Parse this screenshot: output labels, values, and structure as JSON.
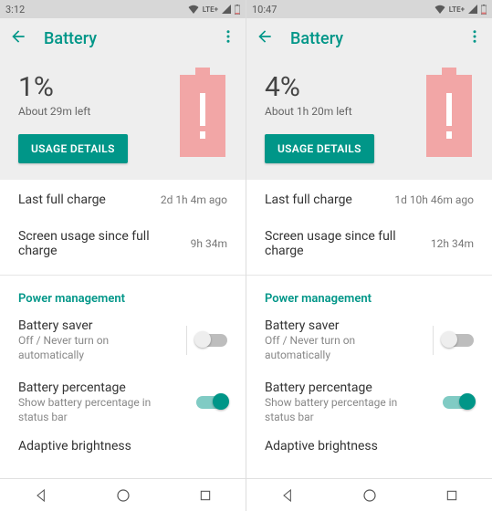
{
  "left": {
    "statusbar": {
      "time": "3:12",
      "network_label": "LTE+"
    },
    "appbar": {
      "title": "Battery"
    },
    "hero": {
      "percent": "1%",
      "time_left": "About 29m left",
      "usage_btn": "USAGE DETAILS"
    },
    "stats": {
      "last_full_label": "Last full charge",
      "last_full_value": "2d 1h 4m ago",
      "screen_usage_label": "Screen usage since full charge",
      "screen_usage_value": "9h 34m"
    },
    "pm_header": "Power management",
    "pm": {
      "saver_title": "Battery saver",
      "saver_desc": "Off / Never turn on automatically",
      "pct_title": "Battery percentage",
      "pct_desc": "Show battery percentage in status bar",
      "adaptive_title": "Adaptive brightness"
    }
  },
  "right": {
    "statusbar": {
      "time": "10:47",
      "network_label": "LTE+"
    },
    "appbar": {
      "title": "Battery"
    },
    "hero": {
      "percent": "4%",
      "time_left": "About 1h 20m left",
      "usage_btn": "USAGE DETAILS"
    },
    "stats": {
      "last_full_label": "Last full charge",
      "last_full_value": "1d 10h 46m ago",
      "screen_usage_label": "Screen usage since full charge",
      "screen_usage_value": "12h 34m"
    },
    "pm_header": "Power management",
    "pm": {
      "saver_title": "Battery saver",
      "saver_desc": "Off / Never turn on automatically",
      "pct_title": "Battery percentage",
      "pct_desc": "Show battery percentage in status bar",
      "adaptive_title": "Adaptive brightness"
    }
  }
}
